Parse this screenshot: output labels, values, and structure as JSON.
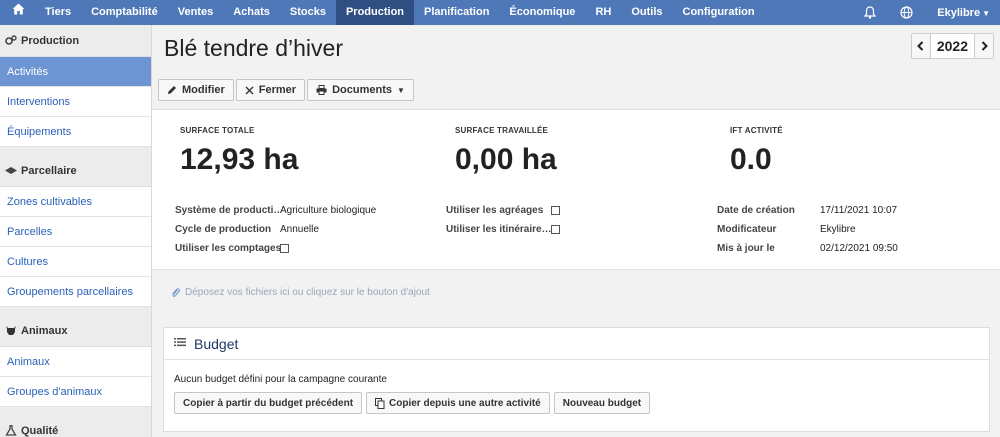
{
  "topnav": {
    "items": [
      "Tiers",
      "Comptabilité",
      "Ventes",
      "Achats",
      "Stocks",
      "Production",
      "Planification",
      "Économique",
      "RH",
      "Outils",
      "Configuration"
    ],
    "active": "Production",
    "user": "Ekylibre"
  },
  "sidebar": {
    "sections": [
      {
        "title": "Production",
        "icon": "gears-icon",
        "items": [
          "Activités",
          "Interventions",
          "Équipements"
        ]
      },
      {
        "title": "Parcellaire",
        "icon": "map-icon",
        "items": [
          "Zones cultivables",
          "Parcelles",
          "Cultures",
          "Groupements parcellaires"
        ]
      },
      {
        "title": "Animaux",
        "icon": "cow-icon",
        "items": [
          "Animaux",
          "Groupes d'animaux"
        ]
      },
      {
        "title": "Qualité",
        "icon": "flask-icon",
        "items": []
      }
    ],
    "active_item": "Activités"
  },
  "page": {
    "title": "Blé tendre d’hiver",
    "year": "2022"
  },
  "toolbar": {
    "edit_label": "Modifier",
    "close_label": "Fermer",
    "documents_label": "Documents"
  },
  "kpis": [
    {
      "label": "SURFACE TOTALE",
      "value": "12,93 ha"
    },
    {
      "label": "SURFACE TRAVAILLÉE",
      "value": "0,00 ha"
    },
    {
      "label": "IFT ACTIVITÉ",
      "value": "0.0"
    }
  ],
  "properties": {
    "col1": [
      {
        "key": "Système de producti…",
        "value": "Agriculture biologique"
      },
      {
        "key": "Cycle de production",
        "value": "Annuelle"
      },
      {
        "key": "Utiliser les comptages",
        "value": ""
      }
    ],
    "col2": [
      {
        "key": "Utiliser les agréages",
        "value": ""
      },
      {
        "key": "Utiliser les itinéraire…",
        "value": ""
      }
    ],
    "col3": [
      {
        "key": "Date de création",
        "value": "17/11/2021 10:07"
      },
      {
        "key": "Modificateur",
        "value": "Ekylibre"
      },
      {
        "key": "Mis à jour le",
        "value": "02/12/2021 09:50"
      }
    ]
  },
  "dropzone": {
    "text": "Déposez vos fichiers ici ou cliquez sur le bouton d'ajout"
  },
  "budget": {
    "title": "Budget",
    "message": "Aucun budget défini pour la campagne courante",
    "buttons": [
      "Copier à partir du budget précédent",
      "Copier depuis une autre activité",
      "Nouveau budget"
    ]
  }
}
